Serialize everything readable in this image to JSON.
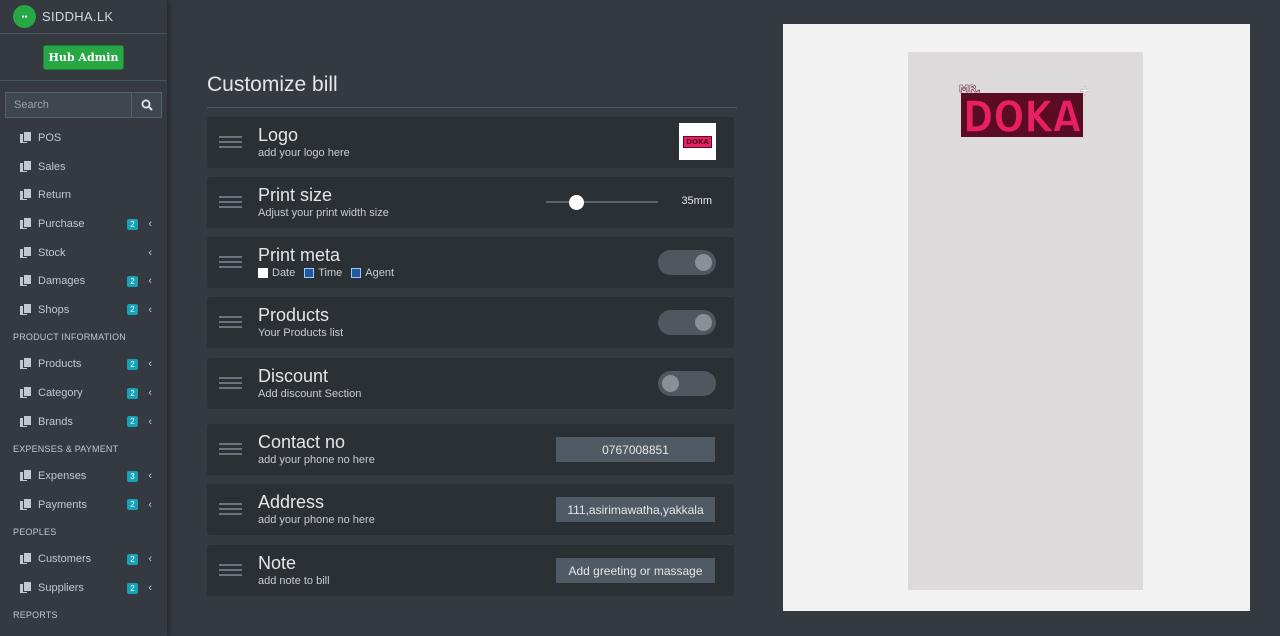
{
  "brand": {
    "name": "SIDDHA.LK",
    "logo_text": "MR.DOKA"
  },
  "hub_button": "Hub Admin",
  "search": {
    "placeholder": "Search"
  },
  "nav": {
    "pos": "POS",
    "sales": "Sales",
    "return": "Return",
    "purchase": {
      "label": "Purchase",
      "badge": "2"
    },
    "stock": "Stock",
    "damages": {
      "label": "Damages",
      "badge": "2"
    },
    "shops": {
      "label": "Shops",
      "badge": "2"
    },
    "header_product": "PRODUCT INFORMATION",
    "products": {
      "label": "Products",
      "badge": "2"
    },
    "category": {
      "label": "Category",
      "badge": "2"
    },
    "brands": {
      "label": "Brands",
      "badge": "2"
    },
    "header_expenses": "EXPENSES & PAYMENT",
    "expenses": {
      "label": "Expenses",
      "badge": "3"
    },
    "payments": {
      "label": "Payments",
      "badge": "2"
    },
    "header_peoples": "PEOPLES",
    "customers": {
      "label": "Customers",
      "badge": "2"
    },
    "suppliers": {
      "label": "Suppliers",
      "badge": "2"
    },
    "header_reports": "REPORTS"
  },
  "page_title": "Customize bill",
  "rows": {
    "logo": {
      "title": "Logo",
      "subtitle": "add your logo here",
      "thumb": "DOKA"
    },
    "print_size": {
      "title": "Print size",
      "subtitle": "Adjust your print width size",
      "value": "35mm",
      "slider_level": 0.27
    },
    "print_meta": {
      "title": "Print meta",
      "date": "Date",
      "time": "Time",
      "agent": "Agent",
      "date_checked": true,
      "time_checked": false,
      "agent_checked": false,
      "enabled": true
    },
    "products": {
      "title": "Products",
      "subtitle": "Your Products list",
      "enabled": true
    },
    "discount": {
      "title": "Discount",
      "subtitle": "Add discount Section",
      "enabled": false
    },
    "contact": {
      "title": "Contact no",
      "subtitle": "add your phone no here",
      "value": "0767008851"
    },
    "address": {
      "title": "Address",
      "subtitle": "add your phone no here",
      "value": "111,asirimawatha,yakkala"
    },
    "note": {
      "title": "Note",
      "subtitle": "add note to bill",
      "placeholder": "Add greeting or massage"
    }
  },
  "colors": {
    "accent_green": "#28a745",
    "badge": "#17a2b8",
    "logo_pink": "#e91e63",
    "logo_dark": "#5a0c25"
  }
}
